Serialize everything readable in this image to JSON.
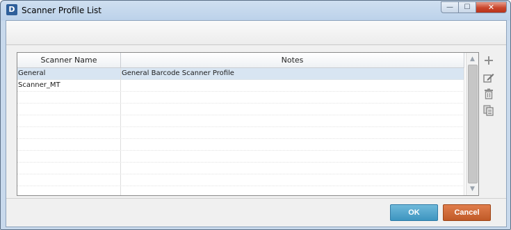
{
  "window": {
    "app_icon_letter": "D",
    "title": "Scanner Profile List",
    "controls": {
      "minimize": "—",
      "maximize": "☐",
      "close": "✕"
    }
  },
  "grid": {
    "columns": [
      "Scanner Name",
      "Notes"
    ],
    "rows": [
      {
        "name": "General",
        "notes": "General Barcode Scanner Profile",
        "selected": true
      },
      {
        "name": "Scanner_MT",
        "notes": "",
        "selected": false
      },
      {
        "name": "",
        "notes": "",
        "selected": false
      },
      {
        "name": "",
        "notes": "",
        "selected": false
      },
      {
        "name": "",
        "notes": "",
        "selected": false
      },
      {
        "name": "",
        "notes": "",
        "selected": false
      },
      {
        "name": "",
        "notes": "",
        "selected": false
      },
      {
        "name": "",
        "notes": "",
        "selected": false
      },
      {
        "name": "",
        "notes": "",
        "selected": false
      },
      {
        "name": "",
        "notes": "",
        "selected": false
      },
      {
        "name": "",
        "notes": "",
        "selected": false
      }
    ],
    "scroll": {
      "up_arrow": "▲",
      "down_arrow": "▼"
    }
  },
  "side_tools": [
    {
      "icon": "add-icon",
      "label": "+"
    },
    {
      "icon": "edit-icon",
      "label": ""
    },
    {
      "icon": "delete-icon",
      "label": ""
    },
    {
      "icon": "copy-icon",
      "label": ""
    }
  ],
  "buttons": {
    "ok": "OK",
    "cancel": "Cancel"
  },
  "colors": {
    "ok": "#4aa3cc",
    "cancel": "#d06a37",
    "selected_row": "#d8e5f2"
  }
}
